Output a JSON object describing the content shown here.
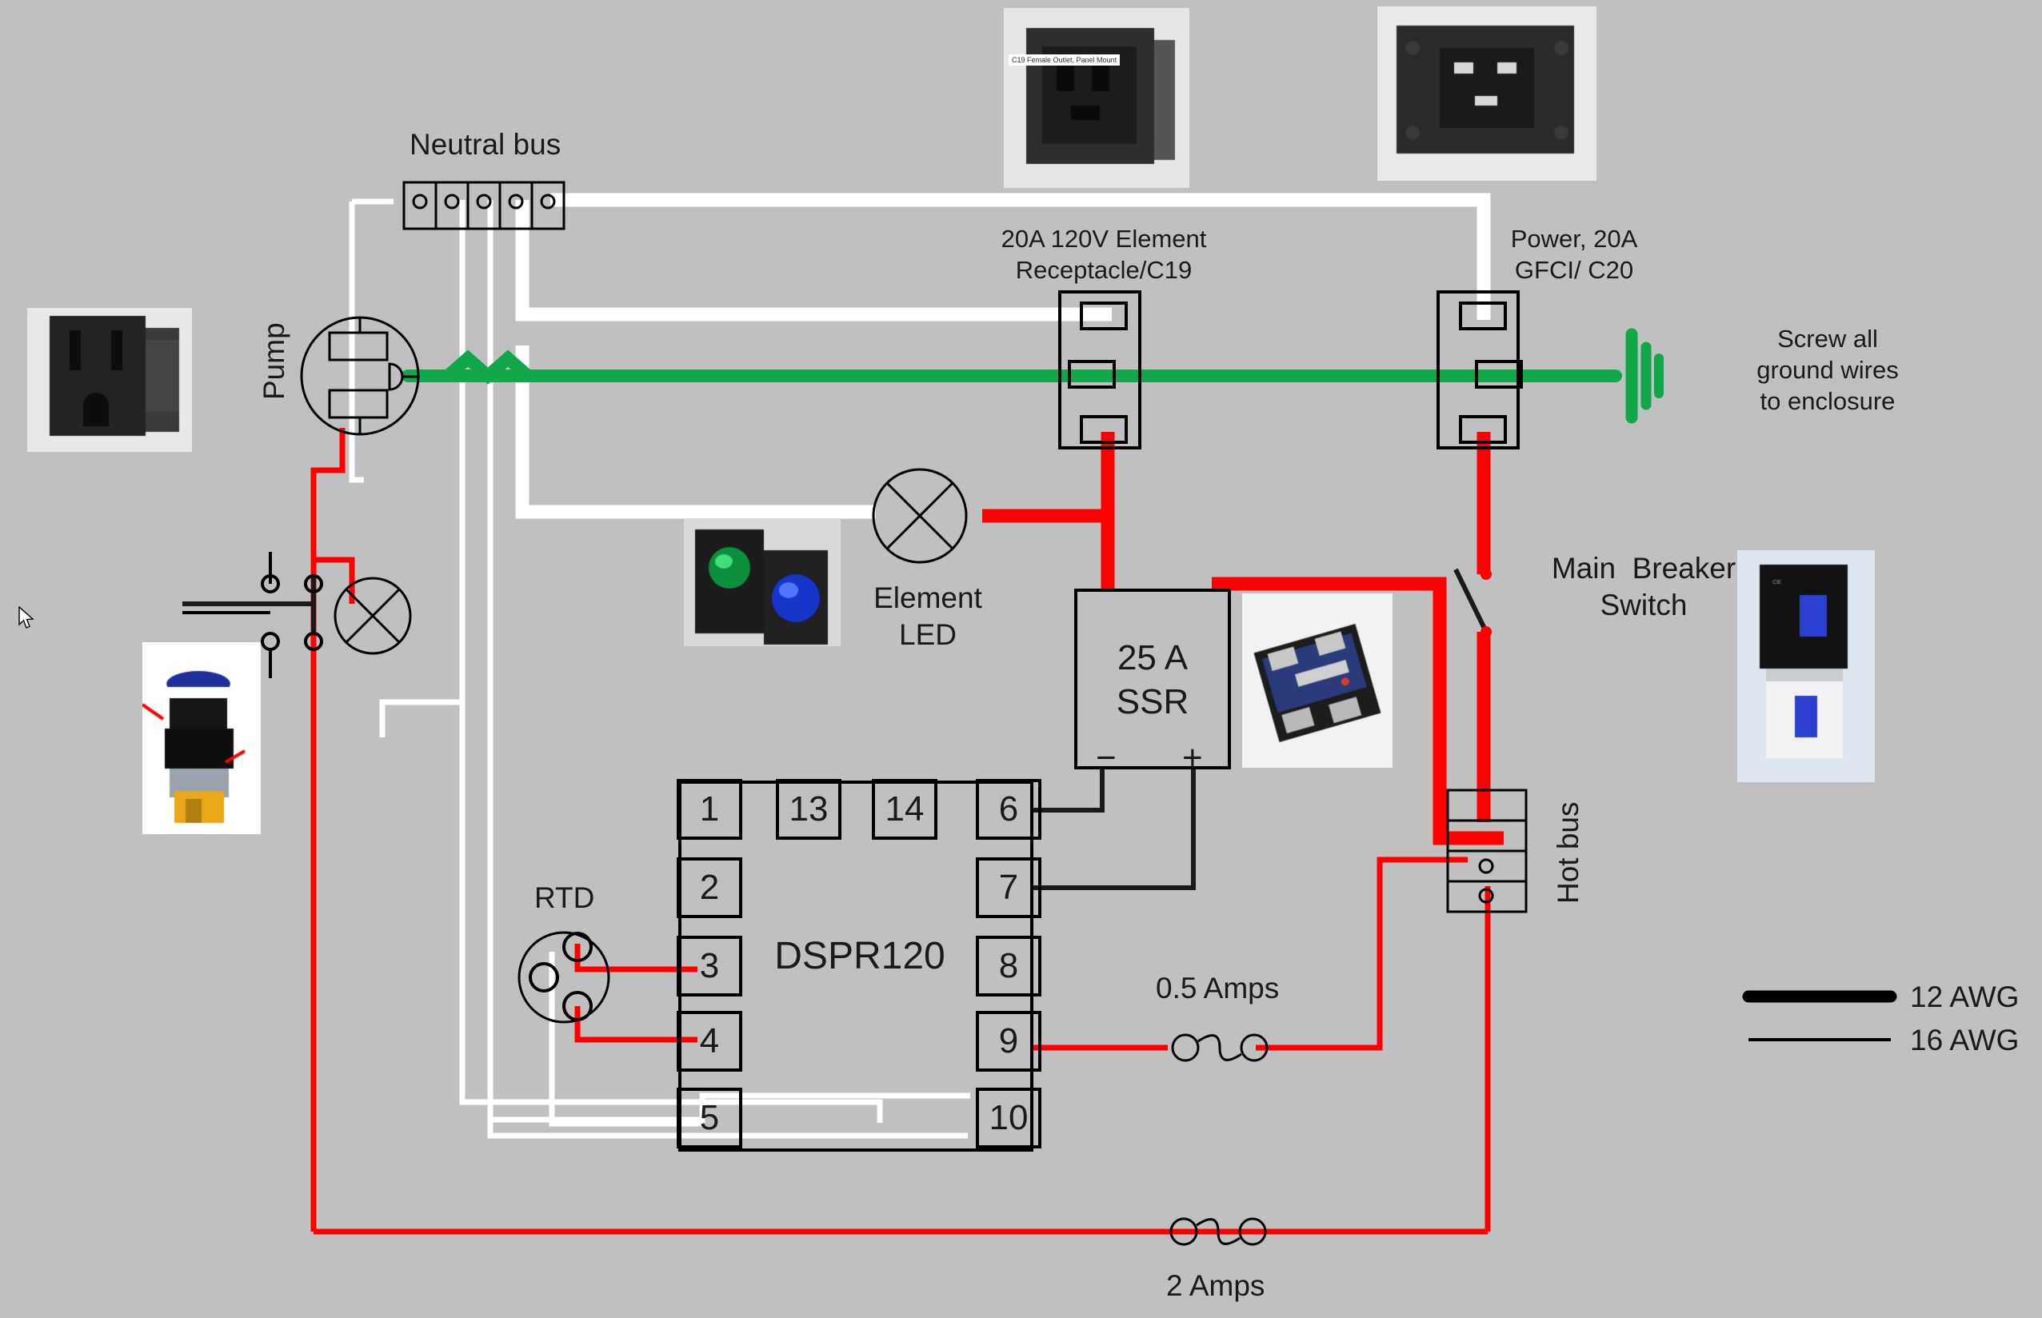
{
  "diagram": {
    "title_alt": "Electric brewery control panel wiring diagram",
    "background_color": "#c0c0c0",
    "colors": {
      "hot_wire": "#ff0000",
      "neutral_wire": "#ffffff",
      "ground_wire": "#12a84a",
      "signal_wire": "#1a1a1a",
      "outline": "#000000",
      "text": "#1a1a1a"
    }
  },
  "labels": {
    "neutral_bus": "Neutral bus",
    "pump": "Pump",
    "element_receptacle": "20A 120V Element\nReceptacle/C19",
    "power_gfci": "Power, 20A\nGFCI/ C20",
    "ground_note": "Screw all\nground wires\nto enclosure",
    "element_led": "Element\nLED",
    "ssr": "25 A\nSSR",
    "ssr_minus": "−",
    "ssr_plus": "+",
    "controller": "DSPR120",
    "rtd": "RTD",
    "main_breaker": "Main  Breaker\nSwitch",
    "hot_bus": "Hot bus",
    "fuse_half_amp": "0.5 Amps",
    "fuse_two_amp": "2 Amps"
  },
  "controller": {
    "name": "DSPR120",
    "terminals_left": [
      "1",
      "2",
      "3",
      "4",
      "5"
    ],
    "terminals_top": [
      "13",
      "14"
    ],
    "terminals_right": [
      "6",
      "7",
      "8",
      "9",
      "10"
    ]
  },
  "legend": {
    "entries": [
      {
        "label": "12 AWG",
        "weight": "thick"
      },
      {
        "label": "16 AWG",
        "weight": "thin"
      }
    ]
  },
  "photos": [
    {
      "name": "nema-outlet-photo",
      "caption": ""
    },
    {
      "name": "c19-female-outlet-photo",
      "caption": "C19 Female Outlet, Panel Mount"
    },
    {
      "name": "c20-male-inlet-photo",
      "caption": ""
    },
    {
      "name": "indicator-lamps-photo",
      "caption": ""
    },
    {
      "name": "pushbutton-switch-photo",
      "caption": ""
    },
    {
      "name": "ssr-module-photo",
      "caption": ""
    },
    {
      "name": "breaker-switch-photo",
      "caption": ""
    }
  ]
}
